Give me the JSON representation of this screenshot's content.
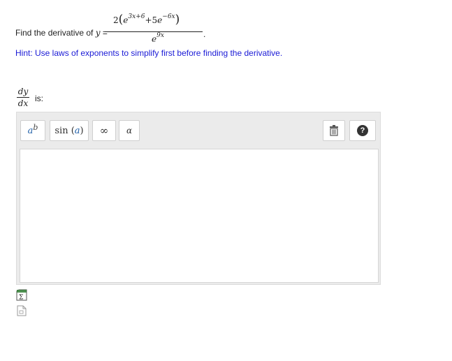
{
  "question": {
    "text": "Find the derivative of",
    "y_var": "y",
    "equals": "=",
    "numerator": {
      "coef": "2",
      "lparen": "(",
      "e1": "e",
      "exp1": "3x+6",
      "plus": "+5",
      "e2": "e",
      "exp2": "−6x",
      "rparen": ")"
    },
    "denominator": {
      "e": "e",
      "exp": "9x"
    },
    "period": "."
  },
  "hint": "Hint: Use laws of exponents to simplify first before finding the derivative.",
  "answer": {
    "dy": "dy",
    "dx": "dx",
    "is_label": "is:",
    "value": ""
  },
  "toolbar": {
    "power_base": "a",
    "power_exp": "b",
    "sin_fn": "sin",
    "sin_arg": "a",
    "sin_lparen": "(",
    "sin_rparen": ")",
    "infinity": "∞",
    "alpha": "α",
    "help": "?"
  },
  "icons": {
    "trash": "trash-icon",
    "help": "help-icon",
    "equation_editor": "equation-editor-icon",
    "preview": "preview-icon"
  }
}
